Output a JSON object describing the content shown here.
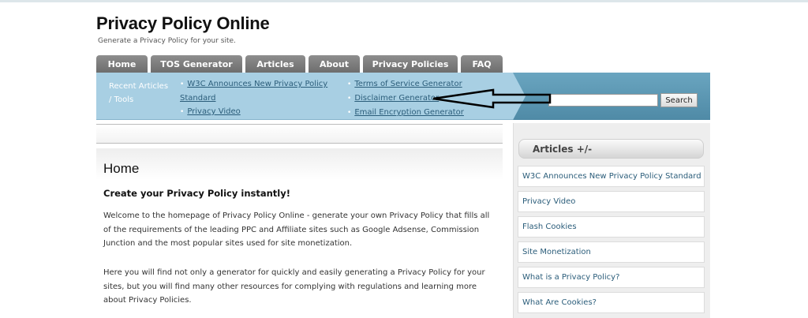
{
  "site": {
    "title": "Privacy Policy Online",
    "tagline": "Generate a Privacy Policy for your site."
  },
  "nav": {
    "tabs": [
      {
        "label": "Home"
      },
      {
        "label": "TOS Generator"
      },
      {
        "label": "Articles"
      },
      {
        "label": "About"
      },
      {
        "label": "Privacy Policies"
      },
      {
        "label": "FAQ"
      }
    ]
  },
  "recent": {
    "label": "Recent Articles / Tools",
    "col1": [
      "W3C Announces New Privacy Policy Standard",
      "Privacy Video"
    ],
    "col2": [
      "Terms of Service Generator",
      "Disclaimer Generator",
      "Email Encryption Generator"
    ]
  },
  "search": {
    "value": "",
    "button_label": "Search"
  },
  "main": {
    "title": "Home",
    "subtitle": "Create your Privacy Policy instantly!",
    "paragraph1": "Welcome to the homepage of Privacy Policy Online - generate your own Privacy Policy that fills all of the requirements of the leading PPC and Affiliate sites such as Google Adsense, Commission Junction and the most popular sites used for site monetization.",
    "paragraph2": "Here you will find not only a generator for quickly and easily generating a Privacy Policy for your sites, but you will find many other resources for complying with regulations and learning more about Privacy Policies."
  },
  "sidebar": {
    "heading": "Articles +/-",
    "items": [
      "W3C Announces New Privacy Policy Standard",
      "Privacy Video",
      "Flash Cookies",
      "Site Monetization",
      "What is a Privacy Policy?",
      "What Are Cookies?"
    ]
  },
  "colors": {
    "nav_tab": "#7d7d7d",
    "recent_bar": "#a8cfe3",
    "search_bar": "#5b97b3",
    "link": "#2b5d7a"
  }
}
